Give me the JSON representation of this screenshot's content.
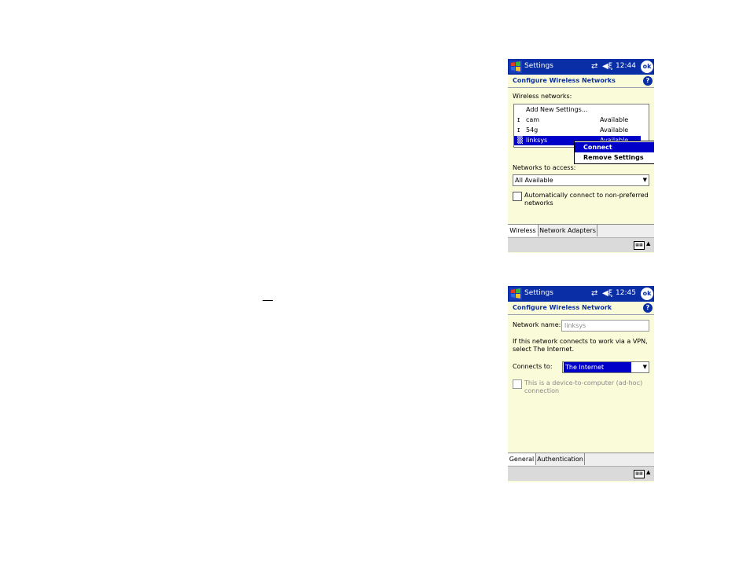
{
  "screen1": {
    "title": "Settings",
    "time": "12:44",
    "ok_label": "ok",
    "connectivity_glyph": "⇄",
    "volume_glyph": "◀ξ",
    "help_glyph": "?",
    "header": "Configure Wireless Networks",
    "networks_label": "Wireless networks:",
    "networks": [
      {
        "name": "Add New Settings...",
        "status": "",
        "icon": ""
      },
      {
        "name": "cam",
        "status": "Available",
        "icon": "signal-icon"
      },
      {
        "name": "54g",
        "status": "Available",
        "icon": "signal-icon"
      },
      {
        "name": "linksys",
        "status": "Available",
        "icon": "network-icon",
        "selected": true
      }
    ],
    "context_menu": [
      "Connect",
      "Remove Settings"
    ],
    "access_label": "Networks to access:",
    "access_value": "All Available",
    "auto_connect_line1": "Automatically connect to non-preferred",
    "auto_connect_line2": "networks",
    "tabs": [
      "Wireless",
      "Network Adapters"
    ]
  },
  "screen2": {
    "title": "Settings",
    "time": "12:45",
    "ok_label": "ok",
    "connectivity_glyph": "⇄",
    "volume_glyph": "◀ξ",
    "help_glyph": "?",
    "header": "Configure Wireless Network",
    "network_name_label": "Network name:",
    "network_name_value": "linksys",
    "vpn_line1": "If this network connects to work via a VPN,",
    "vpn_line2": "select The Internet.",
    "connects_to_label": "Connects to:",
    "connects_to_value": "The Internet",
    "adhoc_line1": "This is a device-to-computer (ad-hoc)",
    "adhoc_line2": "connection",
    "tabs": [
      "General",
      "Authentication"
    ]
  },
  "icons": {
    "keyboard": "keyboard-icon",
    "windows_logo": "windows-flag-icon"
  },
  "colors": {
    "titlebar": "#0a2ea6",
    "selection": "#0000c8",
    "background": "#f9fbd9"
  }
}
